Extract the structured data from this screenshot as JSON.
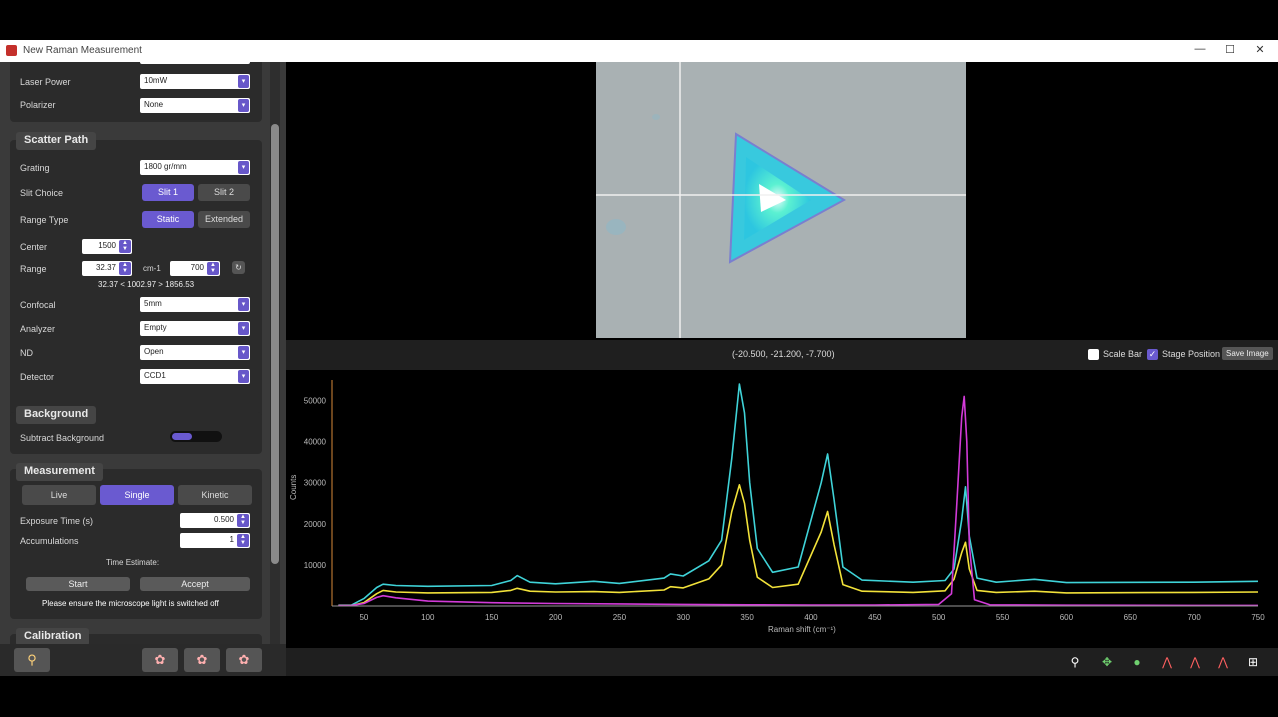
{
  "window": {
    "title": "New Raman Measurement",
    "minimize": "—",
    "maximize": "☐",
    "close": "✕"
  },
  "laser": {
    "power_label": "Laser Power",
    "power_value": "10mW",
    "polarizer_label": "Polarizer",
    "polarizer_value": "None"
  },
  "scatter_path": {
    "title": "Scatter Path",
    "grating_label": "Grating",
    "grating_value": "1800 gr/mm",
    "slit_label": "Slit Choice",
    "slit_options": [
      "Slit 1",
      "Slit 2"
    ],
    "slit_selected": 0,
    "range_type_label": "Range Type",
    "range_type_options": [
      "Static",
      "Extended"
    ],
    "range_type_selected": 0,
    "center_label": "Center",
    "center_value": "1500",
    "range_label": "Range",
    "range_from": "32.37",
    "range_sep": "cm-1",
    "range_to": "700",
    "range_summary": "32.37 < 1002.97 > 1856.53",
    "confocal_label": "Confocal",
    "confocal_value": "5mm",
    "analyzer_label": "Analyzer",
    "analyzer_value": "Empty",
    "nd_label": "ND",
    "nd_value": "Open",
    "detector_label": "Detector",
    "detector_value": "CCD1"
  },
  "background": {
    "title": "Background",
    "subtract_label": "Subtract Background"
  },
  "measurement": {
    "title": "Measurement",
    "modes": [
      "Live",
      "Single",
      "Kinetic"
    ],
    "mode_selected": 1,
    "exposure_label": "Exposure Time (s)",
    "exposure_value": "0.500",
    "accum_label": "Accumulations",
    "accum_value": "1",
    "time_estimate": "Time Estimate:",
    "start_label": "Start",
    "accept_label": "Accept",
    "warning": "Please ensure the microscope light is switched off"
  },
  "calibration": {
    "title": "Calibration"
  },
  "image": {
    "coordinates": "(-20.500, -21.200, -7.700)",
    "scale_bar_label": "Scale Bar",
    "stage_position_label": "Stage Position",
    "save_image_label": "Save Image"
  },
  "colors": {
    "accent": "#6a5ad0",
    "cyan": "#3fd3d8",
    "yellow": "#f2e23a",
    "magenta": "#d23ad8"
  },
  "chart_data": {
    "type": "line",
    "title": "",
    "xlabel": "Raman shift (cm⁻¹)",
    "ylabel": "Counts",
    "xlim": [
      25,
      750
    ],
    "ylim": [
      0,
      55000
    ],
    "xticks": [
      50,
      100,
      150,
      200,
      250,
      300,
      350,
      400,
      450,
      500,
      550,
      600,
      650,
      700,
      750
    ],
    "yticks": [
      10000,
      20000,
      30000,
      40000,
      50000
    ],
    "series": [
      {
        "color": "#3fd3d8",
        "x": [
          30,
          40,
          50,
          60,
          65,
          75,
          100,
          150,
          165,
          170,
          180,
          200,
          230,
          250,
          285,
          290,
          300,
          320,
          330,
          338,
          344,
          348,
          352,
          358,
          370,
          390,
          408,
          413,
          418,
          425,
          440,
          480,
          505,
          512,
          518,
          521,
          524,
          530,
          545,
          575,
          600,
          700,
          750
        ],
        "y": [
          200,
          200,
          1800,
          4500,
          5300,
          5000,
          4800,
          5000,
          6200,
          7400,
          5800,
          5400,
          6000,
          5500,
          6800,
          7800,
          7300,
          11000,
          16000,
          36000,
          54000,
          47000,
          30000,
          14000,
          8200,
          9500,
          30000,
          37000,
          26000,
          9500,
          6300,
          5800,
          6200,
          9000,
          21000,
          29000,
          17000,
          6800,
          5800,
          6500,
          5700,
          5800,
          6000
        ]
      },
      {
        "color": "#f2e23a",
        "x": [
          30,
          40,
          50,
          60,
          65,
          75,
          100,
          150,
          165,
          170,
          180,
          200,
          230,
          250,
          285,
          290,
          300,
          320,
          330,
          338,
          344,
          348,
          352,
          358,
          370,
          390,
          408,
          413,
          418,
          425,
          440,
          480,
          505,
          512,
          518,
          521,
          524,
          530,
          545,
          575,
          600,
          700,
          750
        ],
        "y": [
          100,
          100,
          800,
          3000,
          3800,
          3400,
          3200,
          3300,
          3800,
          4300,
          3600,
          3400,
          3500,
          3300,
          3900,
          4700,
          4400,
          6600,
          10000,
          23000,
          29500,
          25000,
          16000,
          7000,
          4500,
          5300,
          18000,
          23000,
          15000,
          5200,
          3600,
          3300,
          3700,
          6500,
          13000,
          15500,
          9000,
          3800,
          3300,
          3600,
          3200,
          3300,
          3400
        ]
      },
      {
        "color": "#d23ad8",
        "x": [
          30,
          40,
          50,
          60,
          65,
          75,
          100,
          150,
          200,
          250,
          300,
          350,
          400,
          450,
          500,
          510,
          514,
          518,
          520,
          522,
          524,
          528,
          540,
          600,
          700,
          750
        ],
        "y": [
          100,
          100,
          600,
          2100,
          2500,
          2000,
          1200,
          800,
          600,
          500,
          400,
          300,
          250,
          250,
          400,
          3000,
          24000,
          46000,
          51000,
          40000,
          15000,
          1500,
          300,
          200,
          150,
          150
        ]
      }
    ]
  }
}
